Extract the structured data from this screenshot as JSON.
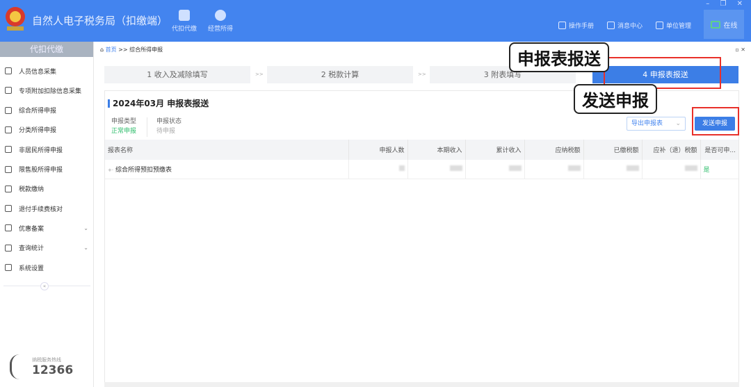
{
  "header": {
    "title": "自然人电子税务局（扣缴端）",
    "nav": [
      {
        "label": "代扣代缴",
        "icon": "wallet-icon"
      },
      {
        "label": "经营所得",
        "icon": "coins-icon"
      }
    ],
    "links": [
      {
        "label": "操作手册",
        "icon": "document-icon"
      },
      {
        "label": "消息中心",
        "icon": "mail-icon"
      },
      {
        "label": "单位管理",
        "icon": "building-icon"
      }
    ],
    "status": "在线",
    "window_controls": "– ❐ ✕"
  },
  "sidebar": {
    "title": "代扣代缴",
    "items": [
      {
        "label": "人员信息采集",
        "icon": "person-icon"
      },
      {
        "label": "专项附加扣除信息采集",
        "icon": "list-icon"
      },
      {
        "label": "综合所得申报",
        "icon": "layers-icon"
      },
      {
        "label": "分类所得申报",
        "icon": "pie-icon"
      },
      {
        "label": "非居民所得申报",
        "icon": "user-icon"
      },
      {
        "label": "限售股所得申报",
        "icon": "bar-chart-icon"
      },
      {
        "label": "税款缴纳",
        "icon": "folder-icon"
      },
      {
        "label": "退付手续费核对",
        "icon": "receipt-icon"
      },
      {
        "label": "优惠备案",
        "icon": "file-icon",
        "expandable": true
      },
      {
        "label": "查询统计",
        "icon": "search-list-icon",
        "expandable": true
      },
      {
        "label": "系统设置",
        "icon": "gear-icon"
      }
    ],
    "hotline_label": "纳税服务热线",
    "hotline": "12366"
  },
  "breadcrumb": {
    "home": "首页",
    "sep": ">>",
    "current": "综合所得申报"
  },
  "steps": [
    {
      "label": "1 收入及减除填写"
    },
    {
      "label": "2 税款计算"
    },
    {
      "label": "3 附表填写"
    },
    {
      "label": "4 申报表报送",
      "active": true
    }
  ],
  "step_sep": ">>",
  "panel": {
    "title": "2024年03月  申报表报送",
    "type_label": "申报类型",
    "type_value": "正常申报",
    "status_label": "申报状态",
    "status_value": "待申报",
    "export_button": "导出申报表",
    "send_button": "发送申报"
  },
  "table": {
    "columns": [
      "报表名称",
      "申报人数",
      "本期收入",
      "累计收入",
      "应纳税额",
      "已缴税额",
      "应补（退）税额",
      "是否可申..."
    ],
    "rows": [
      {
        "name": "综合所得预扣预缴表",
        "can_declare": "是"
      }
    ]
  },
  "callouts": {
    "report_send": "申报表报送",
    "send_declare": "发送申报"
  },
  "colors": {
    "brand": "#4384ef",
    "active_step": "#3c7ee6",
    "success": "#2ebd6b",
    "highlight": "#e8302a"
  }
}
